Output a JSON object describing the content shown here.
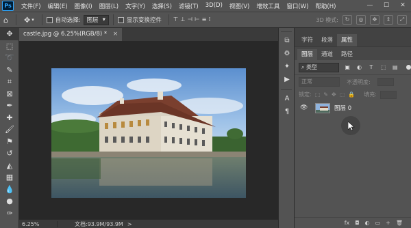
{
  "app": {
    "logo": "Ps"
  },
  "menu": [
    "文件(F)",
    "编辑(E)",
    "图像(I)",
    "图层(L)",
    "文字(Y)",
    "选择(S)",
    "滤镜(T)",
    "3D(D)",
    "视图(V)",
    "增效工具",
    "窗口(W)",
    "帮助(H)"
  ],
  "window": {
    "minimize": "—",
    "maximize": "☐",
    "close": "✕"
  },
  "options": {
    "auto_select_label": "自动选择:",
    "layer_select": "图层",
    "transform_label": "显示变换控件",
    "mode_3d": "3D 模式:"
  },
  "document": {
    "tab_title": "castle.jpg @ 6.25%(RGB/8) *",
    "close": "×"
  },
  "status": {
    "zoom": "6.25%",
    "doc_info": "文档:93.9M/93.9M",
    "arrow": ">"
  },
  "panels": {
    "top_tabs": [
      "字符",
      "段落",
      "属性"
    ],
    "layer_tabs": [
      "图层",
      "通道",
      "路径"
    ],
    "filter_kind": "类型",
    "blend_mode": "正常",
    "opacity_label": "不透明度:",
    "lock_label": "锁定:",
    "fill_label": "填充:",
    "layer_name": "图层 0",
    "footer_icons": [
      "fx",
      "◘",
      "◐",
      "▭",
      "+",
      "🗑"
    ]
  },
  "colors": {
    "accent": "#31a8ff",
    "panel_bg": "#535353",
    "canvas_bg": "#282828"
  }
}
